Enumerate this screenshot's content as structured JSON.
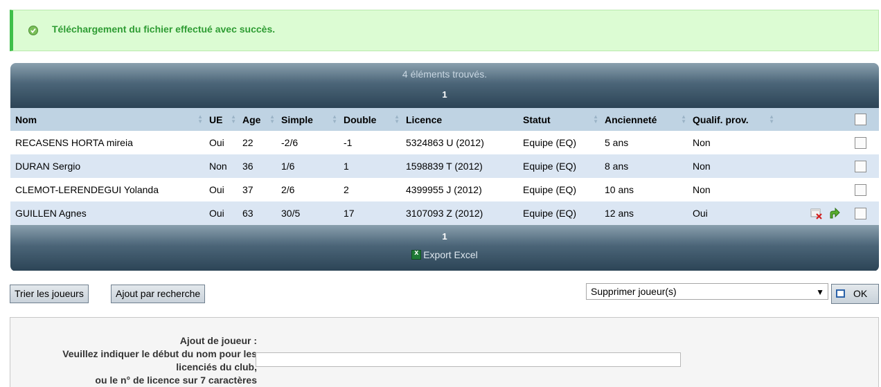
{
  "notification": {
    "message": "Téléchargement du fichier effectué avec succès.",
    "icon": "check-circle-icon",
    "color": "#2e9c33"
  },
  "grid": {
    "found_text": "4 éléments trouvés.",
    "page_top": "1",
    "page_bottom": "1",
    "export_label": "Export Excel",
    "columns": [
      "Nom",
      "UE",
      "Age",
      "Simple",
      "Double",
      "Licence",
      "Statut",
      "Ancienneté",
      "Qualif. prov."
    ],
    "rows": [
      {
        "nom": "RECASENS HORTA mireia",
        "ue": "Oui",
        "age": "22",
        "simple": "-2/6",
        "double": "-1",
        "licence": "5324863 U (2012)",
        "statut": "Equipe (EQ)",
        "anciennete": "5 ans",
        "qualif": "Non"
      },
      {
        "nom": "DURAN Sergio",
        "ue": "Non",
        "age": "36",
        "simple": "1/6",
        "double": "1",
        "licence": "1598839 T (2012)",
        "statut": "Equipe (EQ)",
        "anciennete": "8 ans",
        "qualif": "Non"
      },
      {
        "nom": "CLEMOT-LERENDEGUI Yolanda",
        "ue": "Oui",
        "age": "37",
        "simple": "2/6",
        "double": "2",
        "licence": "4399955 J (2012)",
        "statut": "Equipe (EQ)",
        "anciennete": "10 ans",
        "qualif": "Non"
      },
      {
        "nom": "GUILLEN Agnes",
        "ue": "Oui",
        "age": "63",
        "simple": "30/5",
        "double": "17",
        "licence": "3107093 Z (2012)",
        "statut": "Equipe (EQ)",
        "anciennete": "12 ans",
        "qualif": "Oui"
      }
    ]
  },
  "actions": {
    "sort_button": "Trier les joueurs",
    "search_add_button": "Ajout par recherche",
    "bulk_action_selected": "Supprimer joueur(s)",
    "ok_button": "OK"
  },
  "add_player": {
    "label_line1": "Ajout de joueur :",
    "label_line2": "Veuillez indiquer le début du nom pour les",
    "label_line3": "licenciés du club,",
    "label_line4": "ou le n° de licence sur 7 caractères",
    "input_value": ""
  }
}
